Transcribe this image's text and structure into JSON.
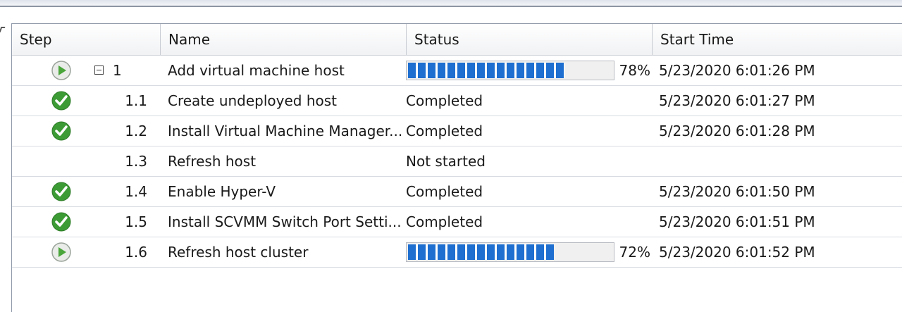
{
  "columns": {
    "step": "Step",
    "name": "Name",
    "status": "Status",
    "start_time": "Start Time"
  },
  "rows": [
    {
      "step": "1",
      "name": "Add virtual machine host",
      "status": "",
      "progress_percent": 78,
      "progress_label": "78%",
      "start_time": "5/23/2020 6:01:26 PM",
      "icon": "running-play-icon",
      "expandable": true
    },
    {
      "step": "1.1",
      "name": "Create undeployed host",
      "status": "Completed",
      "start_time": "5/23/2020 6:01:27 PM",
      "icon": "completed-check-icon"
    },
    {
      "step": "1.2",
      "name": "Install Virtual Machine Manager...",
      "status": "Completed",
      "start_time": "5/23/2020 6:01:28 PM",
      "icon": "completed-check-icon"
    },
    {
      "step": "1.3",
      "name": "Refresh host",
      "status": "Not started",
      "start_time": "",
      "icon": ""
    },
    {
      "step": "1.4",
      "name": "Enable Hyper-V",
      "status": "Completed",
      "start_time": "5/23/2020 6:01:50 PM",
      "icon": "completed-check-icon"
    },
    {
      "step": "1.5",
      "name": "Install SCVMM Switch Port Setti...",
      "status": "Completed",
      "start_time": "5/23/2020 6:01:51 PM",
      "icon": "completed-check-icon"
    },
    {
      "step": "1.6",
      "name": "Refresh host cluster",
      "status": "",
      "progress_percent": 72,
      "progress_label": "72%",
      "start_time": "5/23/2020 6:01:52 PM",
      "icon": "running-play-icon"
    }
  ],
  "colors": {
    "progress_blue": "#1e6fd0",
    "check_green": "#3d9b35"
  }
}
